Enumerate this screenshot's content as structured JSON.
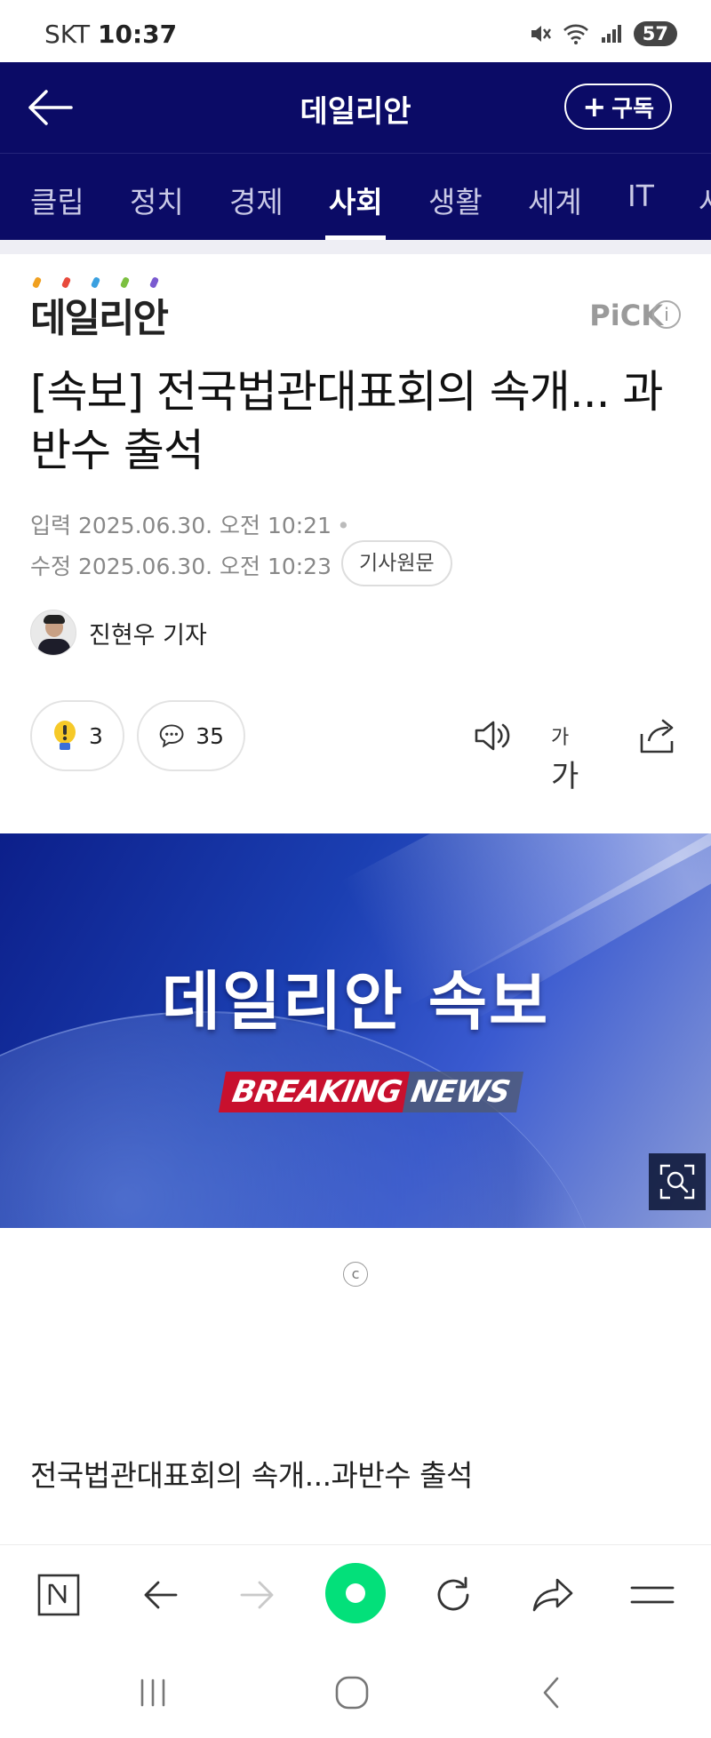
{
  "status_bar": {
    "carrier": "SKT",
    "time": "10:37",
    "battery": "57"
  },
  "header": {
    "title": "데일리안",
    "subscribe_label": "구독"
  },
  "tabs": [
    {
      "label": "클립",
      "active": false
    },
    {
      "label": "정치",
      "active": false
    },
    {
      "label": "경제",
      "active": false
    },
    {
      "label": "사회",
      "active": true
    },
    {
      "label": "생활",
      "active": false
    },
    {
      "label": "세계",
      "active": false
    },
    {
      "label": "IT",
      "active": false
    },
    {
      "label": "사",
      "active": false
    }
  ],
  "article": {
    "press_logo": "데일리안",
    "pick_label": "PiCK",
    "headline": "[속보] 전국법관대표회의 속개... 과반수 출석",
    "input_label": "입력",
    "input_date": "2025.06.30. 오전 10:21",
    "modified_label": "수정",
    "modified_date": "2025.06.30. 오전 10:23",
    "original_button": "기사원문",
    "author": "진현우 기자",
    "reactions": {
      "like_count": "3",
      "comment_count": "35"
    },
    "font_size_label_small": "가",
    "font_size_label_large": "가",
    "image": {
      "title": "데일리안 속보",
      "breaking": "BREAKING",
      "news": "NEWS"
    },
    "copyright_symbol": "c",
    "first_line": "전국법관대표회의 속개...과반수 출석"
  },
  "colors": {
    "navy": "#0b0b66",
    "naver_green": "#03e07a",
    "breaking_red": "#c8102e"
  }
}
